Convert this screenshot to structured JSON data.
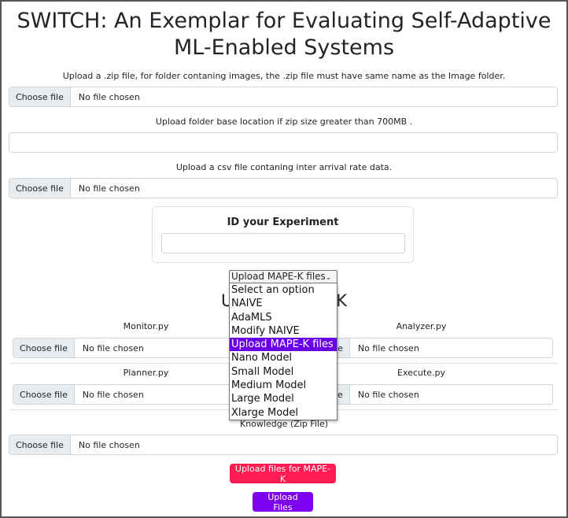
{
  "page": {
    "title": "SWITCH: An Exemplar for Evaluating Self-Adaptive ML-Enabled Systems"
  },
  "upload_zip": {
    "caption": "Upload a .zip file, for folder contaning images, the .zip file must have same name as the Image folder.",
    "button_label": "Choose file",
    "status": "No file chosen"
  },
  "base_location": {
    "caption": "Upload folder base location if zip size greater than 700MB .",
    "value": ""
  },
  "upload_csv": {
    "caption": "Upload a csv file contaning inter arrival rate data.",
    "button_label": "Choose file",
    "status": "No file chosen"
  },
  "experiment": {
    "title": "ID your Experiment",
    "value": ""
  },
  "approach_select": {
    "selected": "Upload MAPE-K files",
    "chevron_icon": "chevron-down-icon",
    "options": [
      "Select an option",
      "NAIVE",
      "AdaMLS",
      "Modify NAIVE",
      "Upload MAPE-K files",
      "Nano Model",
      "Small Model",
      "Medium Model",
      "Large Model",
      "Xlarge Model"
    ]
  },
  "mapek": {
    "heading": "Upload MAPE-K",
    "monitor": {
      "label": "Monitor.py",
      "button_label": "Choose file",
      "status": "No file chosen"
    },
    "analyzer": {
      "label": "Analyzer.py",
      "button_label": "Choose file",
      "status": "No file chosen"
    },
    "planner": {
      "label": "Planner.py",
      "button_label": "Choose file",
      "status": "No file chosen"
    },
    "execute": {
      "label": "Execute.py",
      "button_label": "Choose file",
      "status": "No file chosen"
    },
    "knowledge": {
      "label": "Knowledge (Zip File)",
      "button_label": "Choose file",
      "status": "No file chosen"
    }
  },
  "actions": {
    "upload_mapek_label": "Upload files for MAPE-K",
    "upload_files_label": "Upload Files"
  },
  "colors": {
    "red_button": "#ff1c52",
    "purple_button": "#7d00f0",
    "selected_option": "#6a00e8"
  }
}
